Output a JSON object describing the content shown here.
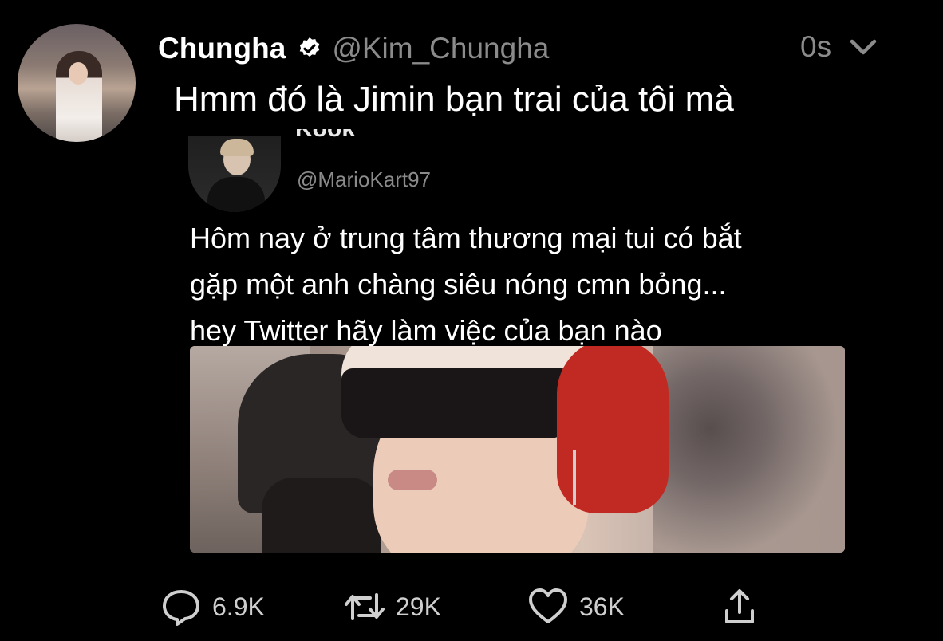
{
  "author": {
    "name": "Chungha",
    "handle": "@Kim_Chungha",
    "verified": true,
    "avatar_icon": "profile-photo"
  },
  "timestamp": "0s",
  "tweet_text": "Hmm đó là Jimin bạn trai của tôi mà",
  "quoted": {
    "name_partial": "Kook",
    "handle": "@MarioKart97",
    "lines": [
      "Hôm nay ở trung tâm thương mại tui có bắt",
      "gặp một anh chàng siêu nóng cmn bỏng...",
      "hey Twitter hãy làm việc của bạn nào"
    ]
  },
  "actions": {
    "reply_count": "6.9K",
    "retweet_count": "29K",
    "like_count": "36K"
  },
  "colors": {
    "background": "#000000",
    "muted": "#8b8b8b",
    "text": "#ffffff"
  }
}
